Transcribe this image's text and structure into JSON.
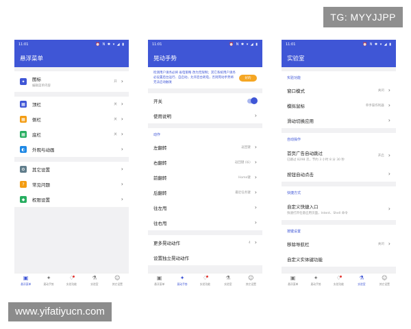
{
  "watermarks": {
    "tg": "TG: MYYJJPP",
    "url": "www.yifatiyucn.com"
  },
  "status": {
    "time": "11:01",
    "icons": "⏰ N ✱ ▾ ◢ ▮"
  },
  "tabs": [
    {
      "label": "悬浮菜单",
      "icon": "▣"
    },
    {
      "label": "晃动手势",
      "icon": "✦"
    },
    {
      "label": "实验功能",
      "icon": "♢"
    },
    {
      "label": "实验室",
      "icon": "⚗"
    },
    {
      "label": "其它设置",
      "icon": "☺"
    }
  ],
  "phone1": {
    "title": "悬浮菜单",
    "icon_row": {
      "label": "图标",
      "sub": "编辑菜单内容",
      "value": "开"
    },
    "rows": [
      {
        "label": "顶栏",
        "value": "关",
        "color": "#3f56d6",
        "icon": "grid-icon"
      },
      {
        "label": "侧栏",
        "value": "关",
        "color": "#f39c12",
        "icon": "grid-icon"
      },
      {
        "label": "底栏",
        "value": "关",
        "color": "#27ae60",
        "icon": "grid-icon"
      },
      {
        "label": "外观与动画",
        "value": "",
        "color": "#1e88e5",
        "icon": "palette-icon"
      }
    ],
    "rows2": [
      {
        "label": "其它设置",
        "color": "#607d8b",
        "icon": "settings-icon"
      },
      {
        "label": "常见问题",
        "color": "#f39c12",
        "icon": "help-icon"
      },
      {
        "label": "权限设置",
        "color": "#27ae60",
        "icon": "shield-icon"
      }
    ]
  },
  "phone2": {
    "title": "晃动手势",
    "notice": "检测用户请务必将 省电策略 改为无限制；其它系统用户请务必设置后台运行、自启动，允许后台耗电，否则晃动手势将无法启动触发",
    "notice_btn": "好的",
    "switch_label": "开关",
    "usage_label": "使用说明",
    "section_action": "动作",
    "actions": [
      {
        "label": "左翻转",
        "value": "返回键"
      },
      {
        "label": "右翻转",
        "value": "返回键 (长)"
      },
      {
        "label": "前翻转",
        "value": "Home键"
      },
      {
        "label": "后翻转",
        "value": "最近任务键"
      },
      {
        "label": "往左甩",
        "value": ""
      },
      {
        "label": "往右甩",
        "value": ""
      }
    ],
    "more_label": "更多晃动动作",
    "more_value": "4",
    "independent_label": "设置独立晃动动作"
  },
  "phone3": {
    "title": "实验室",
    "section1": "实验功能",
    "rows1": [
      {
        "label": "窗口模式",
        "value": "关闭"
      },
      {
        "label": "模拟鼠标",
        "value": "单手操作利器"
      },
      {
        "label": "滑动切换应用",
        "value": ""
      }
    ],
    "section2": "自动操作",
    "skip_label": "首页广告自动跳过",
    "skip_sub": "已跳过 8298 次，节约 3 小时 8 分 30 秒",
    "skip_value": "开启",
    "auto_click_label": "按钮自动点击",
    "section3": "快捷方式",
    "shortcut_label": "自定义快捷入口",
    "shortcut_sub": "快速打开任意应用页面，Intent、Shell 命令",
    "section4": "按键设置",
    "nav_label": "移除导航栏",
    "nav_value": "关闭",
    "custom_label": "自定义实体键功能"
  }
}
